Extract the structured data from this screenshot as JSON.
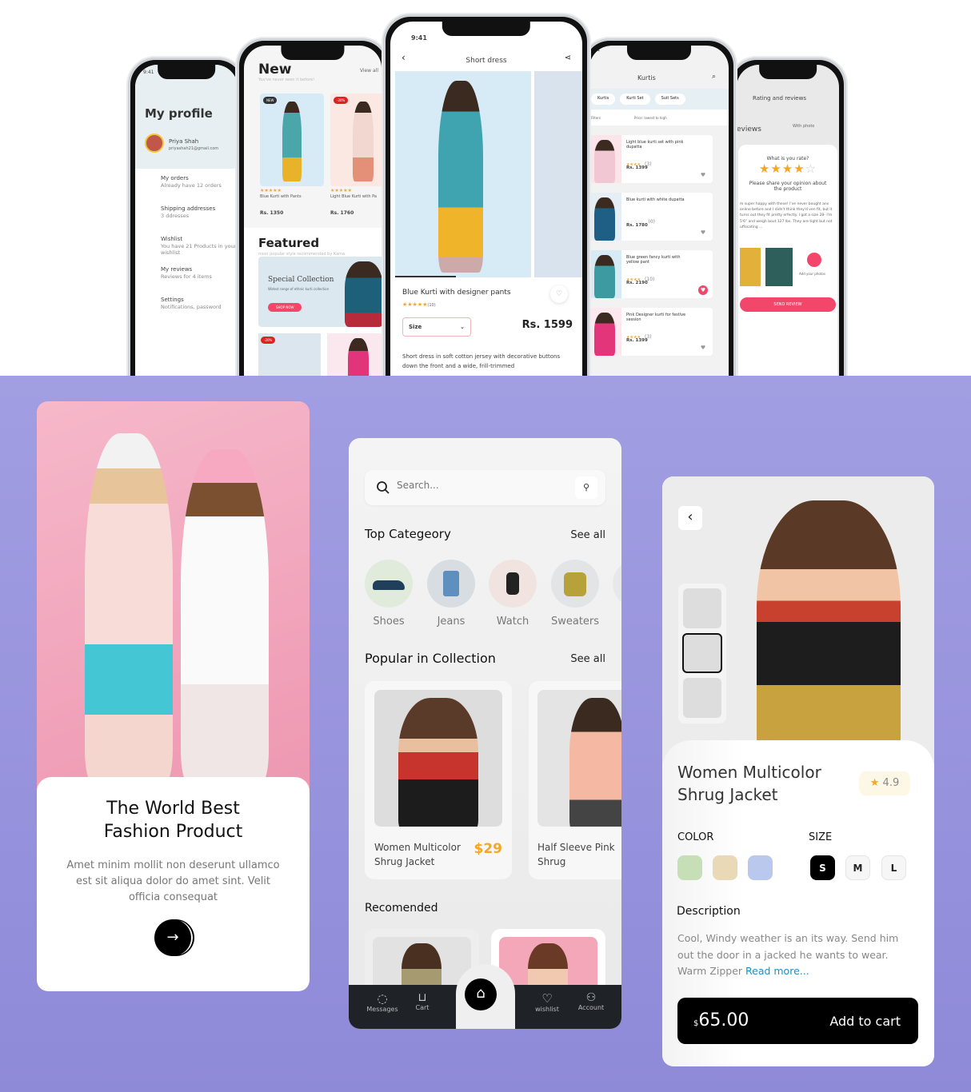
{
  "phones": {
    "profile": {
      "time": "9:41",
      "title": "My profile",
      "user_name": "Priya Shah",
      "user_email": "priyashah21@gmail.com",
      "items": [
        {
          "label": "My orders",
          "sub": "Already have 12 orders"
        },
        {
          "label": "Shipping addresses",
          "sub": "3 ddresses"
        },
        {
          "label": "Wishlist",
          "sub": "You have 21 Products in your wishlist"
        },
        {
          "label": "My reviews",
          "sub": "Reviews for 4 items"
        },
        {
          "label": "Settings",
          "sub": "Notifications, password"
        }
      ]
    },
    "new": {
      "title": "New",
      "subtitle": "You've never seen it before!",
      "view_all": "View all",
      "badge_new": "NEW",
      "badge_discount": "-20%",
      "products": [
        {
          "name": "Blue Kurti with Pants",
          "price": "Rs. 1350",
          "reviews": "(10)"
        },
        {
          "name": "Light Blue Kurti with Pa",
          "price": "Rs. 1760",
          "reviews": "(10)"
        }
      ],
      "featured_title": "Featured",
      "featured_subtitle": "most popular style recommended by Kama",
      "banner_title": "Special Collection",
      "banner_sub": "Widest range of ethnic kurti collection",
      "banner_button": "SHOP NOW",
      "badge_discount2": "-20%"
    },
    "detail": {
      "time": "9:41",
      "title": "Short dress",
      "product_name": "Blue Kurti with designer pants",
      "reviews": "(10)",
      "size_label": "Size",
      "price": "Rs. 1599",
      "description": "Short dress in soft cotton jersey with decorative buttons down the front and a wide, frill-trimmed"
    },
    "kurtis": {
      "time": "9:41",
      "title": "Kurtis",
      "chips": [
        "Kurtis",
        "Kurti Set",
        "Suit Sets"
      ],
      "filters": "Filters",
      "sort": "Price: lowest to high",
      "items": [
        {
          "name": "Light blue kurti set with pink dupatta",
          "price": "Rs. 1399",
          "reviews": "(3)"
        },
        {
          "name": "Blue kurti with white dupatta",
          "price": "Rs. 1780",
          "reviews": "(0)"
        },
        {
          "name": "Blue green fancy kurti with yellow pant",
          "price": "Rs. 2190",
          "reviews": "(10)"
        },
        {
          "name": "Pink Designer kurti for festive session",
          "price": "Rs. 1399",
          "reviews": "(3)"
        }
      ]
    },
    "review": {
      "title": "Rating and reviews",
      "reviews_label": "eviews",
      "with_photo": "With photo",
      "question": "What is you rate?",
      "rating": 4,
      "rating_max": 5,
      "prompt": "Please share your opinion about the product",
      "text": "m super happy with these! I've never bought ans online before and I didn't think they'd ven fit, but it turns out they fit pretty erfectly. I got a size 28- I'm 5'6\" and weigh bout 127 lbs. They are tight but not uffocating ...",
      "add_photos": "Add your photos",
      "send": "SEND REVIEW"
    }
  },
  "onboarding": {
    "title_line1": "The World Best",
    "title_line2": "Fashion Product",
    "description": "Amet minim mollit non deserunt ullamco est sit aliqua dolor do amet sint. Velit officia consequat",
    "next_icon": "arrow-right"
  },
  "home": {
    "search_placeholder": "Search...",
    "top_category": "Top Categeory",
    "see_all": "See all",
    "categories": [
      {
        "label": "Shoes"
      },
      {
        "label": "Jeans"
      },
      {
        "label": "Watch"
      },
      {
        "label": "Sweaters"
      }
    ],
    "popular": "Popular in Collection",
    "see_all2": "See all",
    "products": [
      {
        "name_line1": "Women Multicolor",
        "name_line2": "Shrug Jacket",
        "price": "$29"
      },
      {
        "name_line1": "Half Sleeve Pink",
        "name_line2": "Shrug"
      }
    ],
    "recommended": "Recomended",
    "nav": [
      {
        "label": "Messages",
        "icon": "chat"
      },
      {
        "label": "Cart",
        "icon": "cart"
      },
      {
        "label": "wishlist",
        "icon": "heart"
      },
      {
        "label": "Account",
        "icon": "user"
      }
    ],
    "price_color": "#f5a623"
  },
  "product": {
    "title_line1": "Women Multicolor",
    "title_line2": "Shrug Jacket",
    "rating": "4.9",
    "color_label": "COLOR",
    "size_label": "SIZE",
    "colors": [
      "#c7dfb6",
      "#e9d9b6",
      "#bac8ee"
    ],
    "sizes": [
      "S",
      "M",
      "L"
    ],
    "selected_size": "S",
    "description_label": "Description",
    "description": "Cool, Windy weather is an its way. Send him out the door in a jacked he wants to wear. Warm Zipper ",
    "read_more": "Read more...",
    "currency": "$",
    "price": "65.00",
    "add_to_cart": "Add to cart",
    "link_color": "#1a8fc9"
  }
}
